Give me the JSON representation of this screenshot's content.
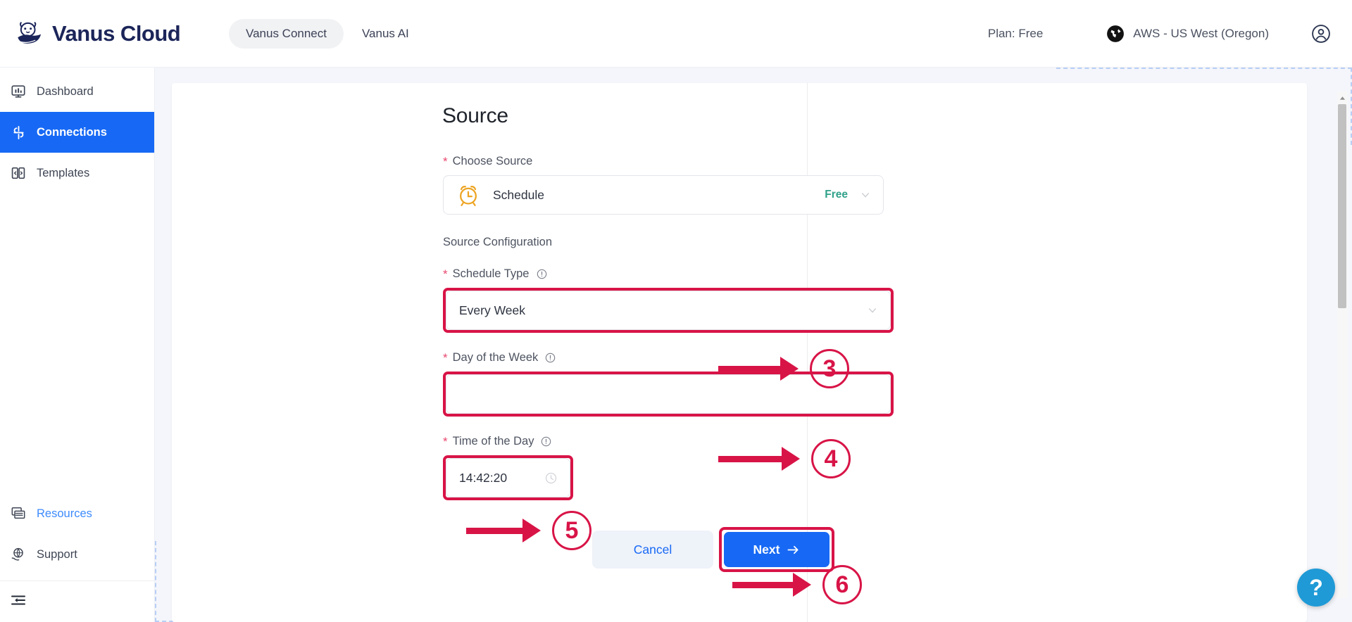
{
  "header": {
    "brand": "Vanus Cloud",
    "brand_logo_icon": "seal-logo-icon",
    "nav": [
      {
        "label": "Vanus Connect",
        "active": true
      },
      {
        "label": "Vanus AI",
        "active": false
      }
    ],
    "plan": "Plan: Free",
    "region": "AWS - US West (Oregon)",
    "region_icon": "globe-icon",
    "account_icon": "user-circle-icon"
  },
  "sidebar": {
    "items": [
      {
        "label": "Dashboard",
        "icon": "monitor-chart-icon",
        "active": false
      },
      {
        "label": "Connections",
        "icon": "connections-icon",
        "active": true
      },
      {
        "label": "Templates",
        "icon": "templates-icon",
        "active": false
      }
    ],
    "bottom_items": [
      {
        "label": "Resources",
        "icon": "resources-list-icon",
        "link": true
      },
      {
        "label": "Support",
        "icon": "globe-hand-icon",
        "link": false
      }
    ],
    "collapse_icon": "collapse-sidebar-icon"
  },
  "main": {
    "title": "Source",
    "choose_source": {
      "label": "Choose Source",
      "required": true,
      "icon": "alarm-clock-icon",
      "value": "Schedule",
      "badge": "Free",
      "chevron_icon": "chevron-down-icon"
    },
    "section_label": "Source Configuration",
    "fields": [
      {
        "label": "Schedule Type",
        "required": true,
        "info_icon": "info-circle-icon",
        "value": "Every Week",
        "placeholder": "",
        "control": "select",
        "chevron_icon": "chevron-down-icon",
        "highlighted": true
      },
      {
        "label": "Day of the Week",
        "required": true,
        "info_icon": "info-circle-icon",
        "value": "",
        "placeholder": "",
        "control": "select",
        "chevron_icon": "",
        "highlighted": true
      },
      {
        "label": "Time of the Day",
        "required": true,
        "info_icon": "info-circle-icon",
        "value": "14:42:20",
        "placeholder": "",
        "control": "time",
        "trailing_icon": "clock-icon",
        "highlighted": true
      }
    ],
    "buttons": {
      "cancel": "Cancel",
      "next": "Next",
      "next_icon": "arrow-right-icon"
    }
  },
  "annotations": [
    {
      "number": "3"
    },
    {
      "number": "4"
    },
    {
      "number": "5"
    },
    {
      "number": "6"
    }
  ],
  "help": {
    "label": "?",
    "icon": "question-mark-icon"
  },
  "colors": {
    "accent_blue": "#1769f5",
    "annotation_red": "#d81447",
    "badge_green": "#2fa189",
    "brand_navy": "#1b2559",
    "help_blue": "#1f9ad6",
    "canvas": "#f4f6fb",
    "dashed_guide": "#b8cef5"
  }
}
